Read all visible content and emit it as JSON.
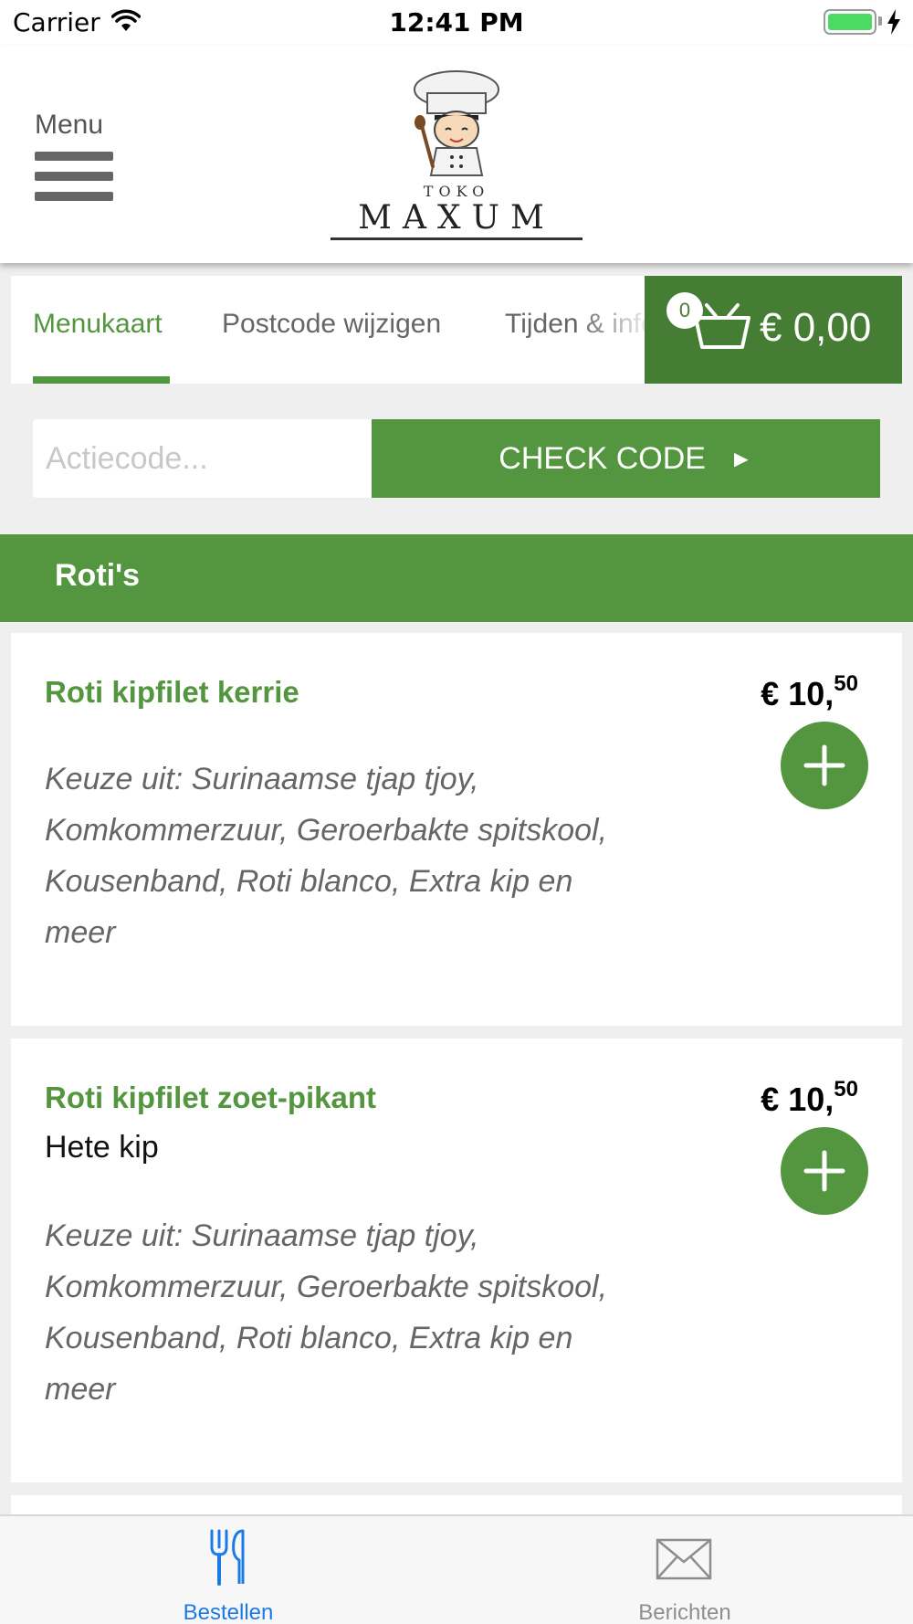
{
  "status_bar": {
    "carrier": "Carrier",
    "time": "12:41 PM"
  },
  "header": {
    "menu_label": "Menu",
    "logo_small": "TOKO",
    "logo_name": "MAXUM"
  },
  "tabs": [
    {
      "label": "Menukaart",
      "active": true
    },
    {
      "label": "Postcode wijzigen",
      "active": false
    },
    {
      "label": "Tijden & info",
      "active": false
    }
  ],
  "cart": {
    "count": "0",
    "total": "€ 0,00"
  },
  "promo": {
    "placeholder": "Actiecode...",
    "button_label": "CHECK CODE",
    "arrow": "►"
  },
  "section": {
    "title": "Roti's"
  },
  "products": [
    {
      "name": "Roti kipfilet kerrie",
      "subtitle": "",
      "description": "Keuze uit: Surinaamse tjap tjoy, Komkommerzuur, Geroerbakte spitskool, Kousenband, Roti blanco, Extra kip en meer",
      "price_main": "€ 10,",
      "price_cents": "50"
    },
    {
      "name": "Roti kipfilet zoet-pikant",
      "subtitle": "Hete kip",
      "description": "Keuze uit: Surinaamse tjap tjoy, Komkommerzuur, Geroerbakte spitskool, Kousenband, Roti blanco, Extra kip en meer",
      "price_main": "€ 10,",
      "price_cents": "50"
    }
  ],
  "bottom_nav": [
    {
      "label": "Bestellen",
      "icon": "cutlery-icon",
      "active": true
    },
    {
      "label": "Berichten",
      "icon": "envelope-icon",
      "active": false
    }
  ],
  "colors": {
    "brand_green": "#54963f",
    "cart_green": "#447d33",
    "active_blue": "#1a7be6",
    "inactive_gray": "#8e8e8e"
  }
}
